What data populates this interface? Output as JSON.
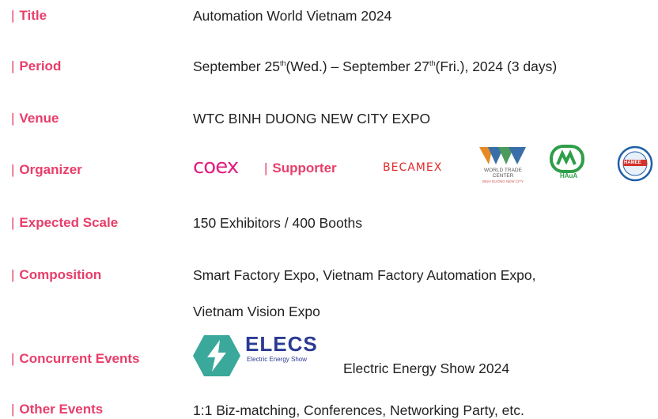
{
  "rows": {
    "title": {
      "label": "Title",
      "value": "Automation World Vietnam 2024"
    },
    "period": {
      "label": "Period",
      "start_text": "September 25",
      "start_sup": "th",
      "mid_text": "(Wed.) – September 27",
      "end_sup": "th",
      "end_text": "(Fri.), 2024 (3 days)"
    },
    "venue": {
      "label": "Venue",
      "value": "WTC BINH DUONG NEW CITY EXPO"
    },
    "organizer": {
      "label": "Organizer",
      "organizer_logo": "coex",
      "supporter_label": "Supporter",
      "supporter_logos": {
        "becamex": "BECAMEX",
        "wtc_line1": "WORLD TRADE",
        "wtc_line2": "CENTER",
        "wtc_line3": "BINH DUONG NEW CITY",
        "haua": "HAuA",
        "hamee": "HAMEE"
      }
    },
    "scale": {
      "label": "Expected Scale",
      "value": "150 Exhibitors / 400 Booths"
    },
    "composition": {
      "label": "Composition",
      "line1": "Smart Factory Expo, Vietnam Factory Automation Expo,",
      "line2": "Vietnam Vision Expo"
    },
    "concurrent": {
      "label": "Concurrent Events",
      "logo_word": "ELECS",
      "logo_sub": "Electric Energy Show",
      "value": "Electric Energy Show 2024"
    },
    "other": {
      "label": "Other Events",
      "value": "1:1 Biz-matching, Conferences, Networking Party, etc."
    }
  },
  "bar_glyph": "|",
  "colors": {
    "label": "#e83e6a",
    "text": "#222222",
    "coex": "#e31e7f",
    "becamex": "#e32b2b",
    "elecs": "#2b3a93",
    "elecs_icon": "#3aa89a",
    "haua": "#2e9e48",
    "hamee": "#1e5fa8"
  }
}
